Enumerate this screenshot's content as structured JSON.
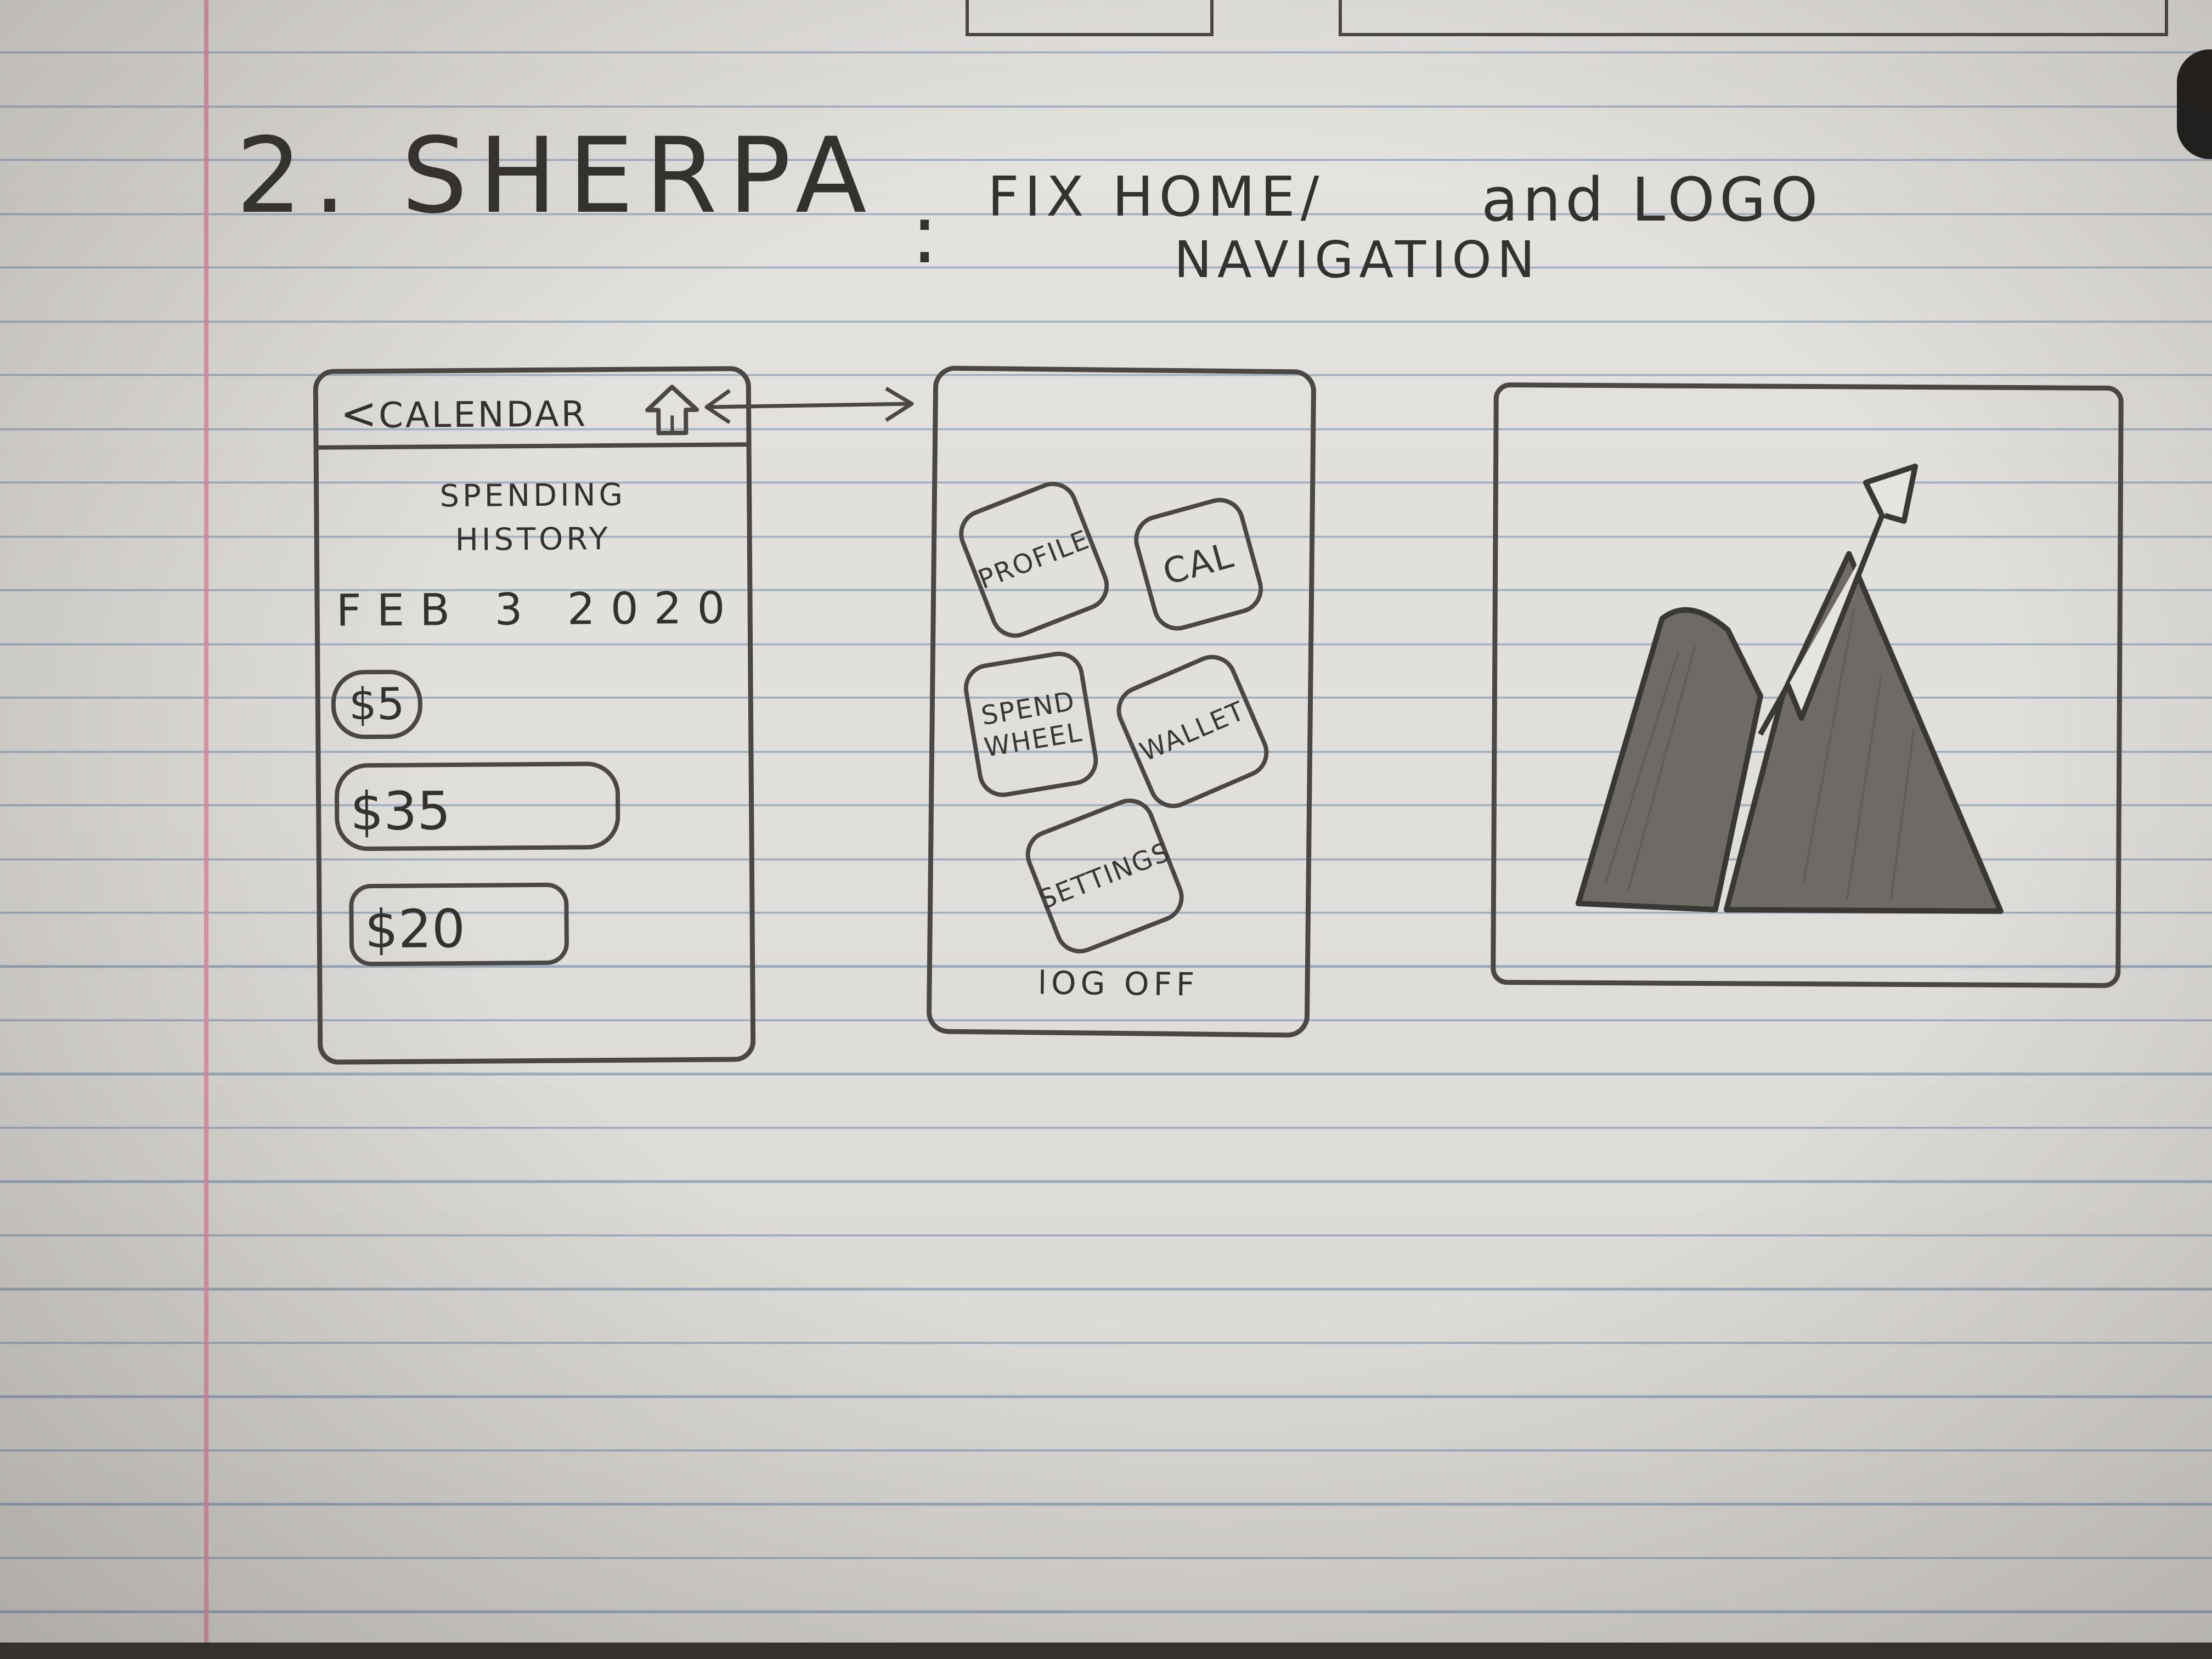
{
  "title": {
    "number": "2.",
    "app_name": "SHERPA",
    "colon": ":",
    "note_line1": "FIX HOME/",
    "note_and": "and LOGO",
    "note_line2": "NAVIGATION"
  },
  "calendar_screen": {
    "back_glyph": "<",
    "header_title": "CALENDAR",
    "home_icon": "home-icon",
    "subtitle": "SPENDING\nHISTORY",
    "date": "FEB 3 2020",
    "amounts": [
      "$5",
      "$35",
      "$20"
    ]
  },
  "home_screen": {
    "tiles": {
      "profile": "PROFILE",
      "cal": "CAL",
      "spend_wheel": "SPEND\nWHEEL",
      "wallet": "WALLET",
      "settings": "SETTINGS"
    },
    "log_off": "lOG OFF"
  },
  "logo": {
    "icon": "mountain-arrow-logo-icon",
    "fill_color": "#6e6b67"
  },
  "colors": {
    "paper": "#e6e4e0",
    "rule_line": "#9fb0c2",
    "margin_line": "#e48aa0",
    "pencil": "#4a4744"
  }
}
